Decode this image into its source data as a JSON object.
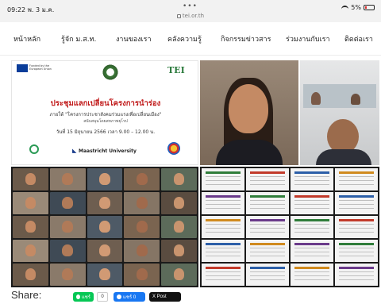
{
  "status_bar": {
    "time": "09:22",
    "date": "พ. 3 ม.ค.",
    "dots": "•••",
    "url": "tei.or.th",
    "battery": "5%"
  },
  "nav": {
    "items": [
      {
        "label": "หน้าหลัก"
      },
      {
        "label": "รู้จัก ม.ส.ท."
      },
      {
        "label": "งานของเรา"
      },
      {
        "label": "คลังความรู้"
      },
      {
        "label": "กิจกรรมข่าวสาร"
      },
      {
        "label": "ร่วมงานกับเรา"
      },
      {
        "label": "ติดต่อเรา"
      }
    ]
  },
  "poster": {
    "eu_text": "Funded by the European Union",
    "tei_logo": "TEI",
    "title": "ประชุมแลกเปลี่ยนโครงการนำร่อง",
    "subtitle": "ภายใต้ \"โครงการประชาสังคมร่วมแรงเพื่อเปลี่ยนเมือง\"",
    "supported_by": "สนับสนุนโดยสหภาพยุโรป",
    "date_line": "วันที่ 15 มิถุนายน 2566 เวลา 9.00 – 12.00 น.",
    "partner": "Maastricht University"
  },
  "share": {
    "label": "Share:",
    "line_label": "แชร์",
    "line_count": "0",
    "fb_label": "แชร์ 0",
    "x_label": "X Post"
  },
  "colors": {
    "poster_title": "#c01818",
    "line_green": "#06c755",
    "facebook_blue": "#1877f2"
  }
}
